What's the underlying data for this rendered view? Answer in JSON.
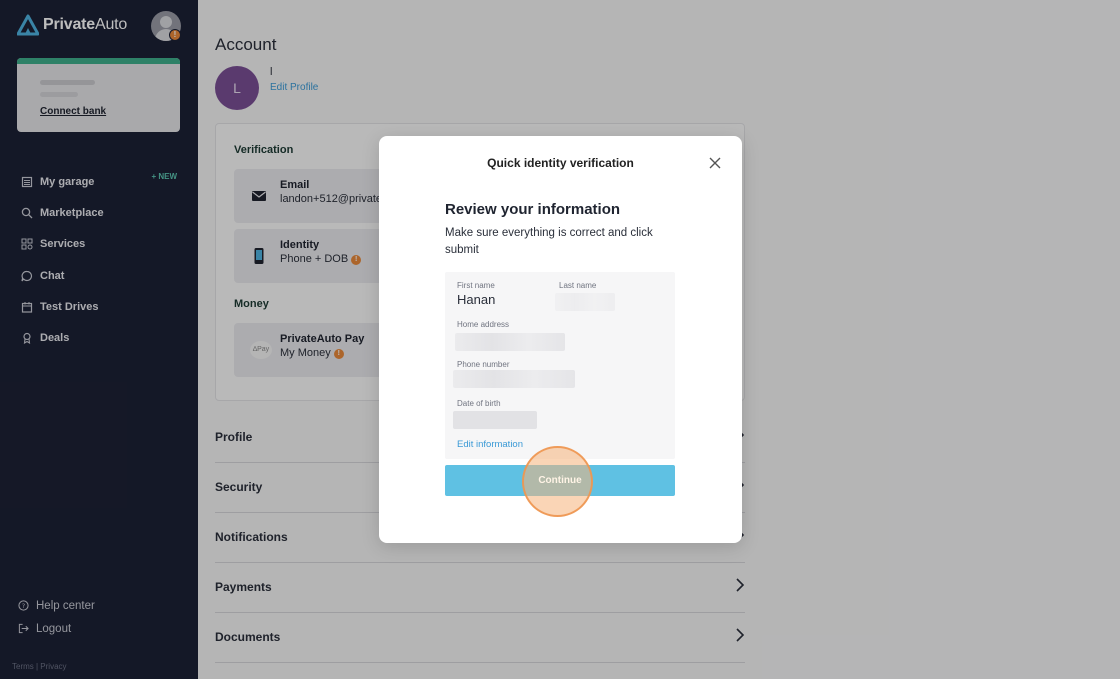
{
  "brand": {
    "name_bold": "Private",
    "name_light": "Auto",
    "accent": "#3fae8b"
  },
  "sidebar": {
    "bank_card": {
      "link_label": "Connect bank"
    },
    "nav_items": [
      {
        "label": "My garage",
        "icon": "garage-icon",
        "badge": "+ NEW"
      },
      {
        "label": "Marketplace",
        "icon": "search-icon"
      },
      {
        "label": "Services",
        "icon": "grid-icon"
      },
      {
        "label": "Chat",
        "icon": "chat-icon"
      },
      {
        "label": "Test Drives",
        "icon": "calendar-icon"
      },
      {
        "label": "Deals",
        "icon": "ribbon-icon"
      }
    ],
    "bottom_links": [
      {
        "label": "Help center",
        "icon": "help-icon"
      },
      {
        "label": "Logout",
        "icon": "logout-icon"
      }
    ],
    "legal": "Terms | Privacy"
  },
  "account": {
    "title": "Account",
    "avatar_initial": "L",
    "profile_name": "l",
    "edit_profile": "Edit Profile",
    "verification_label": "Verification",
    "money_label": "Money",
    "email_tile": {
      "title": "Email",
      "value": "landon+512@private"
    },
    "identity_tile": {
      "title": "Identity",
      "value": "Phone + DOB"
    },
    "pay_tile": {
      "title": "PrivateAuto Pay",
      "value": "My Money",
      "logo": "∆Pay"
    },
    "rows": [
      "Profile",
      "Security",
      "Notifications",
      "Payments",
      "Documents"
    ]
  },
  "modal": {
    "title": "Quick identity verification",
    "heading": "Review your information",
    "subtitle": "Make sure everything is correct and click submit",
    "fields": {
      "first_name_label": "First name",
      "first_name_value": "Hanan",
      "last_name_label": "Last name",
      "home_address_label": "Home address",
      "phone_label": "Phone number",
      "dob_label": "Date of birth"
    },
    "edit_info": "Edit information",
    "continue_label": "Continue"
  }
}
